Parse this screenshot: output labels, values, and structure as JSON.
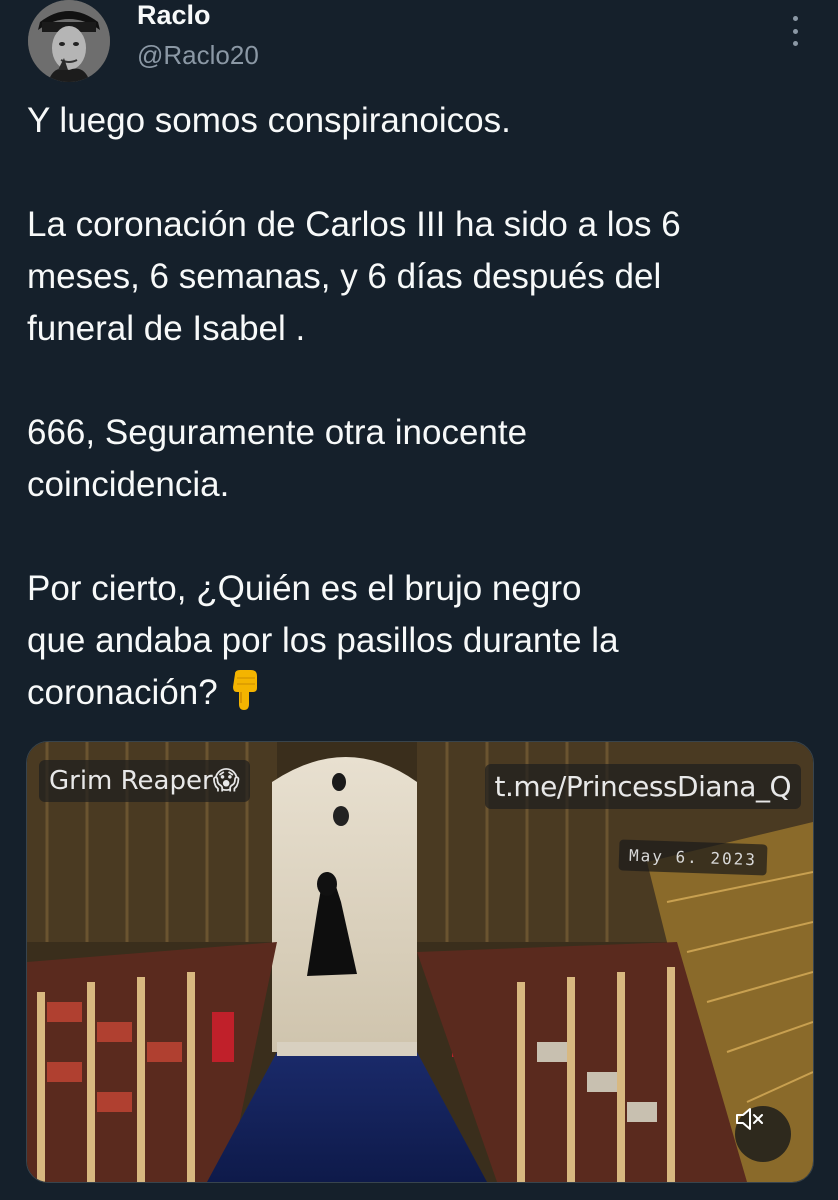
{
  "author": {
    "display_name": "Raclo",
    "handle": "@Raclo20",
    "avatar_icon": "avatar-portrait-icon"
  },
  "menu": {
    "icon": "more-vertical-icon"
  },
  "tweet": {
    "line1": "Y luego somos conspiranoicos.",
    "para2_l1": "La coronación de Carlos III ha sido a los 6",
    "para2_l2": "meses, 6 semanas, y 6 días después del",
    "para2_l3": "funeral de Isabel .",
    "para3_l1": "666, Seguramente otra inocente",
    "para3_l2": "coincidencia.",
    "para4_l1": "Por cierto, ¿Quién es el brujo negro",
    "para4_l2": "que andaba por los pasillos durante la",
    "para4_l3": "coronación?",
    "emoji_icon": "pointing-down-hand-icon"
  },
  "media": {
    "label_left": "Grim Reaper😱",
    "label_right": "t.me/PrincessDiana_Q",
    "date": "May 6. 2023",
    "mute_icon": "speaker-muted-icon"
  },
  "colors": {
    "background": "#15202b",
    "text": "#f7f9f9",
    "secondary": "#8b98a5"
  }
}
